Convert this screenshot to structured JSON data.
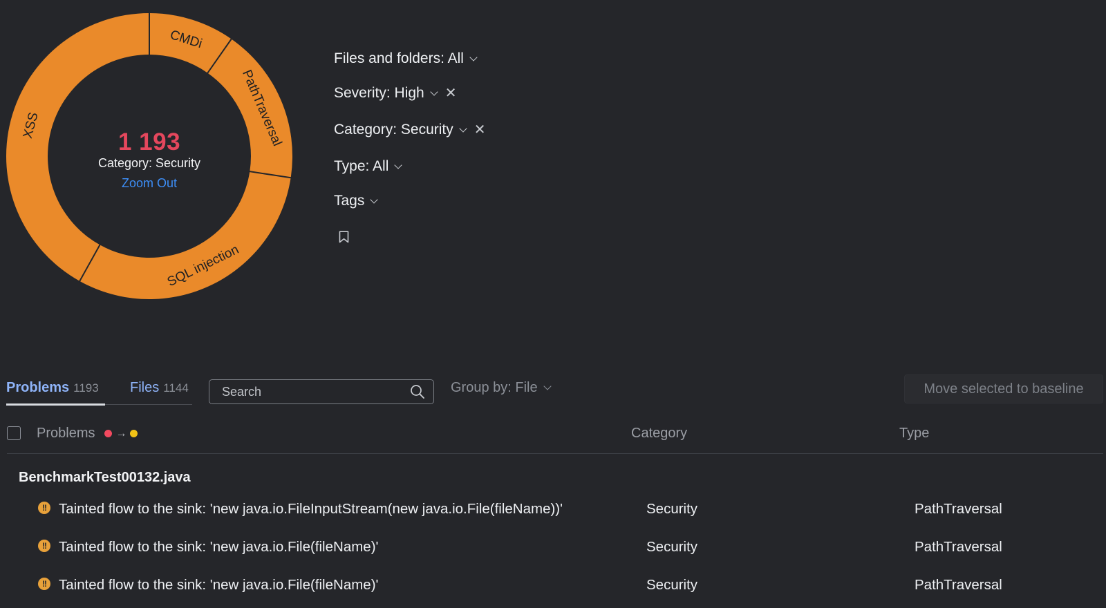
{
  "donut": {
    "fill_color": "#ea8a2a",
    "divider_color": "#25262a",
    "segments": [
      {
        "name": "CMDi",
        "value": 116
      },
      {
        "name": "PathTraversal",
        "value": 211
      },
      {
        "name": "SQL injection",
        "value": 366
      },
      {
        "name": "XSS",
        "value": 500
      }
    ],
    "total": "1 193",
    "center_label": "Category: Security",
    "zoom_out": "Zoom Out"
  },
  "filters": {
    "files_folders": "Files and folders: All",
    "severity": "Severity: High",
    "category": "Category: Security",
    "type": "Type: All",
    "tags": "Tags"
  },
  "toolbar": {
    "tab_problems_label": "Problems",
    "tab_problems_count": "1193",
    "tab_files_label": "Files",
    "tab_files_count": "1144",
    "search_placeholder": "Search",
    "group_by": "Group by: File",
    "baseline_button": "Move selected to baseline"
  },
  "table": {
    "headers": {
      "problems": "Problems",
      "category": "Category",
      "type": "Type"
    },
    "severity_colors": {
      "from": "#f2495f",
      "to": "#f2c216"
    },
    "group": {
      "file_name": "BenchmarkTest00132.java",
      "rows": [
        {
          "text": "Tainted flow to the sink: 'new java.io.FileInputStream(new java.io.File(fileName))'",
          "category": "Security",
          "type": "PathTraversal"
        },
        {
          "text": "Tainted flow to the sink: 'new java.io.File(fileName)'",
          "category": "Security",
          "type": "PathTraversal"
        },
        {
          "text": "Tainted flow to the sink: 'new java.io.File(fileName)'",
          "category": "Security",
          "type": "PathTraversal"
        }
      ]
    }
  },
  "icons": {
    "search": "search-icon",
    "bookmark": "bookmark-icon",
    "warning": "warning-icon",
    "close": "close-icon",
    "chevron": "chevron-down-icon"
  }
}
